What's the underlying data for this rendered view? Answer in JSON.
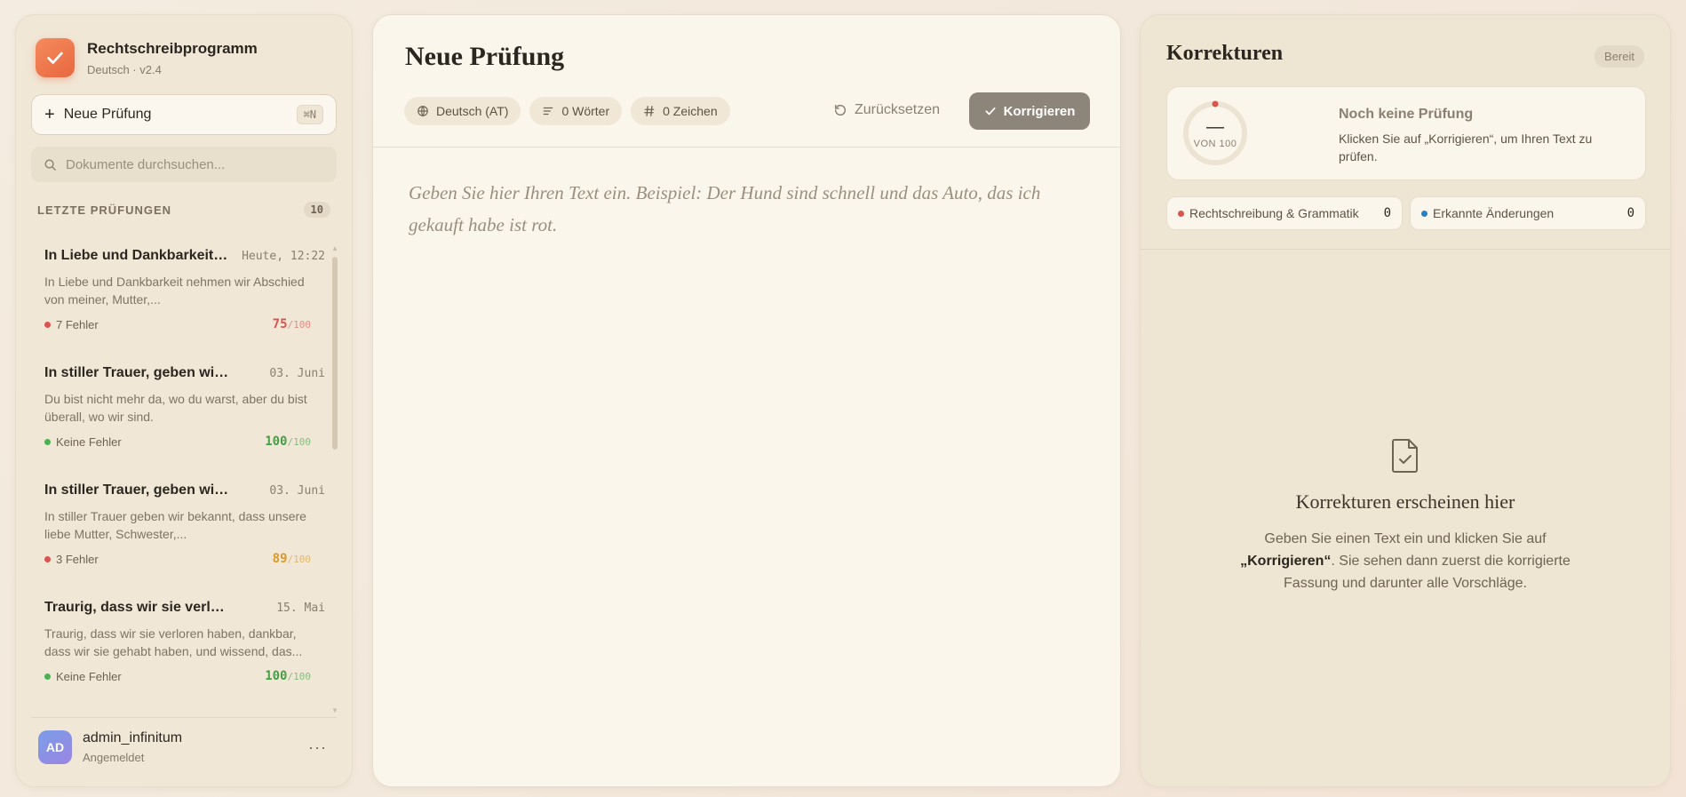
{
  "app": {
    "name": "Rechtschreibprogramm",
    "subtitle": "Deutsch · v2.4"
  },
  "sidebar": {
    "new_check_label": "Neue Prüfung",
    "new_check_shortcut": "⌘N",
    "search_placeholder": "Dokumente durchsuchen...",
    "recent_title": "LETZTE PRÜFUNGEN",
    "recent_count": "10",
    "documents": [
      {
        "title": "In Liebe und Dankbarkeit nehmen wir Abschied",
        "date": "Heute, 12:22",
        "snippet": "In Liebe und Dankbarkeit nehmen wir Abschied von meiner, Mutter,...",
        "status": "7 Fehler",
        "status_color": "#d9534f",
        "score": "75",
        "score_of": "/100",
        "score_color": "#d9534f"
      },
      {
        "title": "In stiller Trauer, geben wir bekannt",
        "date": "03. Juni",
        "snippet": "Du bist nicht mehr da, wo du warst, aber du bist überall, wo wir sind.",
        "status": "Keine Fehler",
        "status_color": "#4caf50",
        "score": "100",
        "score_of": "/100",
        "score_color": "#43a047"
      },
      {
        "title": "In stiller Trauer, geben wir bekannt",
        "date": "03. Juni",
        "snippet": "In stiller Trauer geben wir bekannt, dass unsere liebe Mutter, Schwester,...",
        "status": "3 Fehler",
        "status_color": "#d9534f",
        "score": "89",
        "score_of": "/100",
        "score_color": "#d99a2b"
      },
      {
        "title": "Traurig, dass wir sie verloren haben",
        "date": "15. Mai",
        "snippet": "Traurig, dass wir sie verloren haben, dankbar, dass wir sie gehabt haben, und wissend, das...",
        "status": "Keine Fehler",
        "status_color": "#4caf50",
        "score": "100",
        "score_of": "/100",
        "score_color": "#43a047"
      }
    ],
    "user": {
      "initials": "AD",
      "name": "admin_infinitum",
      "status": "Angemeldet",
      "more": "···"
    }
  },
  "editor": {
    "title": "Neue Prüfung",
    "language": "Deutsch (AT)",
    "words": "0 Wörter",
    "chars": "0 Zeichen",
    "reset_label": "Zurücksetzen",
    "correct_label": "Korrigieren",
    "placeholder": "Geben Sie hier Ihren Text ein. Beispiel: Der Hund sind schnell und das Auto, das ich gekauft habe ist rot."
  },
  "corrections": {
    "title": "Korrekturen",
    "status_badge": "Bereit",
    "score_value": "—",
    "score_of": "VON 100",
    "headline": "Noch keine Prüfung",
    "description": "Klicken Sie auf „Korrigieren“, um Ihren Text zu prüfen.",
    "stats": [
      {
        "label": "Rechtschreibung & Grammatik",
        "count": "0",
        "color": "#d9534f"
      },
      {
        "label": "Erkannte Änderungen",
        "count": "0",
        "color": "#2a7fc1"
      }
    ],
    "empty_title": "Korrekturen erscheinen hier",
    "empty_desc_before": "Geben Sie einen Text ein und klicken Sie auf ",
    "empty_desc_bold": "„Korrigieren“",
    "empty_desc_after": ". Sie sehen dann zuerst die korrigierte Fassung und darunter alle Vorschläge."
  },
  "colors": {
    "brand": "#ee7548",
    "accent_button": "#8e857a",
    "error": "#d9534f",
    "success": "#43a047",
    "warning": "#d99a2b"
  },
  "icons": [
    "check-icon",
    "plus-icon",
    "search-icon",
    "globe-icon",
    "lines-icon",
    "hash-icon",
    "reset-icon",
    "document-check-icon"
  ]
}
